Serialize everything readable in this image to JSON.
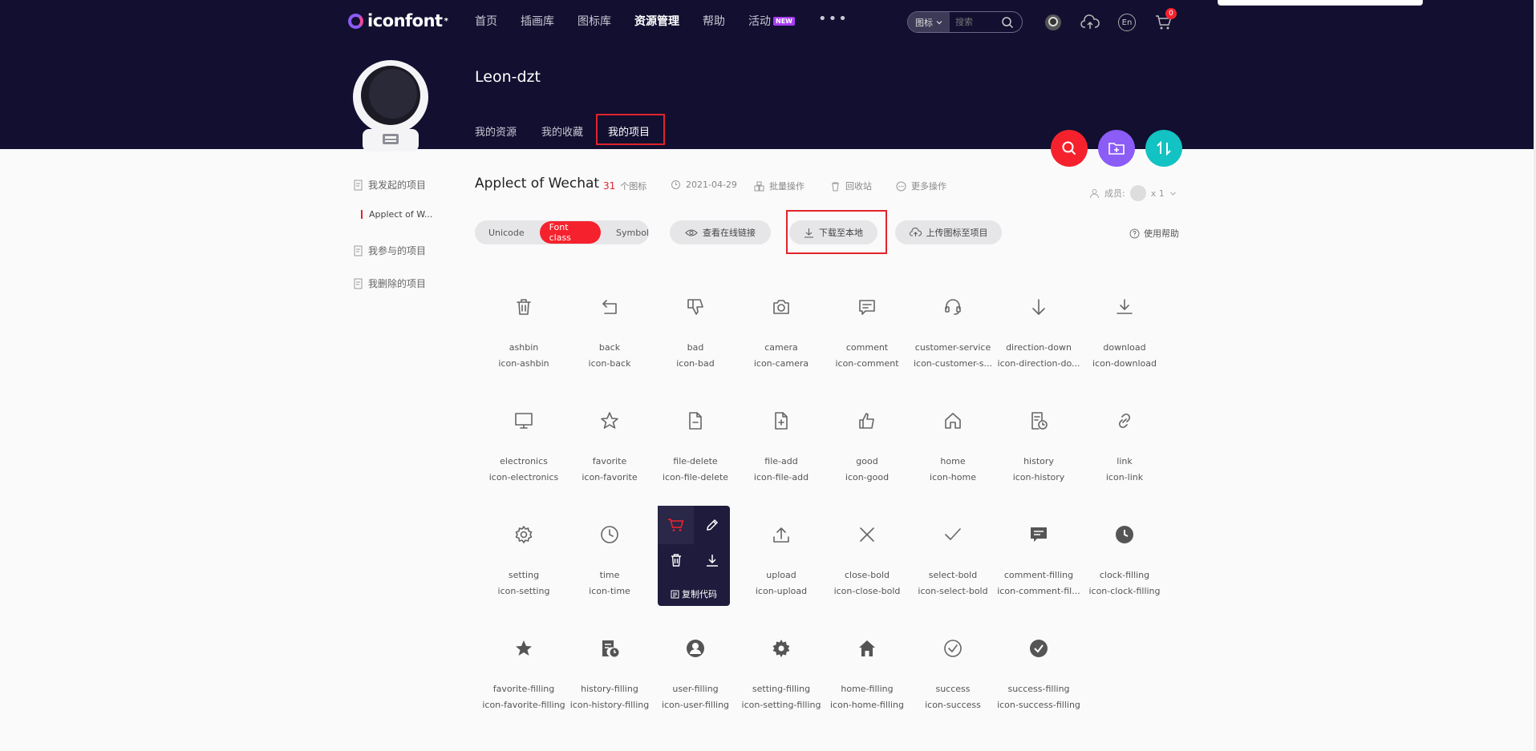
{
  "header": {
    "logo_text": "iconfont",
    "logo_sup": "*",
    "nav": [
      "首页",
      "插画库",
      "图标库",
      "资源管理",
      "帮助",
      "活动"
    ],
    "nav_active_index": 3,
    "new_badge": "NEW",
    "more": "•••",
    "search_type": "图标",
    "search_placeholder": "搜索",
    "lang": "En",
    "cart_count": "0"
  },
  "profile": {
    "username": "Leon-dzt",
    "tabs": [
      "我的资源",
      "我的收藏",
      "我的项目"
    ],
    "active_tab_index": 2
  },
  "sidebar": {
    "started": "我发起的项目",
    "current_project": "Applect of W...",
    "joined": "我参与的项目",
    "deleted": "我删除的项目"
  },
  "project": {
    "title": "Applect of Wechat",
    "icon_count": "31",
    "icon_count_unit": "个图标",
    "date": "2021-04-29",
    "batch": "批量操作",
    "recycle": "回收站",
    "more_ops": "更多操作",
    "members_label": "成员:",
    "members_count": "x 1"
  },
  "toolbar": {
    "modes": [
      "Unicode",
      "Font class",
      "Symbol"
    ],
    "active_mode_index": 1,
    "view_online": "查看在线链接",
    "download": "下载至本地",
    "upload": "上传图标至项目",
    "help": "使用帮助"
  },
  "hover_card": {
    "copy_label": "复制代码"
  },
  "icons": [
    {
      "name": "ashbin",
      "cls": "icon-ashbin",
      "glyph": "trash-icon"
    },
    {
      "name": "back",
      "cls": "icon-back",
      "glyph": "back-icon"
    },
    {
      "name": "bad",
      "cls": "icon-bad",
      "glyph": "thumb-down-icon"
    },
    {
      "name": "camera",
      "cls": "icon-camera",
      "glyph": "camera-icon"
    },
    {
      "name": "comment",
      "cls": "icon-comment",
      "glyph": "comment-icon"
    },
    {
      "name": "customer-service",
      "cls": "icon-customer-s...",
      "glyph": "headset-icon"
    },
    {
      "name": "direction-down",
      "cls": "icon-direction-do...",
      "glyph": "arrow-down-icon"
    },
    {
      "name": "download",
      "cls": "icon-download",
      "glyph": "download-icon"
    },
    {
      "name": "electronics",
      "cls": "icon-electronics",
      "glyph": "monitor-icon"
    },
    {
      "name": "favorite",
      "cls": "icon-favorite",
      "glyph": "star-icon"
    },
    {
      "name": "file-delete",
      "cls": "icon-file-delete",
      "glyph": "file-minus-icon"
    },
    {
      "name": "file-add",
      "cls": "icon-file-add",
      "glyph": "file-plus-icon"
    },
    {
      "name": "good",
      "cls": "icon-good",
      "glyph": "thumb-up-icon"
    },
    {
      "name": "home",
      "cls": "icon-home",
      "glyph": "home-icon"
    },
    {
      "name": "history",
      "cls": "icon-history",
      "glyph": "history-icon"
    },
    {
      "name": "link",
      "cls": "icon-link",
      "glyph": "link-icon"
    },
    {
      "name": "setting",
      "cls": "icon-setting",
      "glyph": "gear-icon"
    },
    {
      "name": "time",
      "cls": "icon-time",
      "glyph": "clock-icon"
    },
    {
      "name": "",
      "cls": "",
      "glyph": "hidden-icon"
    },
    {
      "name": "upload",
      "cls": "icon-upload",
      "glyph": "upload-icon"
    },
    {
      "name": "close-bold",
      "cls": "icon-close-bold",
      "glyph": "close-icon"
    },
    {
      "name": "select-bold",
      "cls": "icon-select-bold",
      "glyph": "check-icon"
    },
    {
      "name": "comment-filling",
      "cls": "icon-comment-fil...",
      "glyph": "comment-filled-icon"
    },
    {
      "name": "clock-filling",
      "cls": "icon-clock-filling",
      "glyph": "clock-filled-icon"
    },
    {
      "name": "favorite-filling",
      "cls": "icon-favorite-filling",
      "glyph": "star-filled-icon"
    },
    {
      "name": "history-filling",
      "cls": "icon-history-filling",
      "glyph": "history-filled-icon"
    },
    {
      "name": "user-filling",
      "cls": "icon-user-filling",
      "glyph": "user-filled-icon"
    },
    {
      "name": "setting-filling",
      "cls": "icon-setting-filling",
      "glyph": "gear-filled-icon"
    },
    {
      "name": "home-filling",
      "cls": "icon-home-filling",
      "glyph": "home-filled-icon"
    },
    {
      "name": "success",
      "cls": "icon-success",
      "glyph": "check-circle-icon"
    },
    {
      "name": "success-filling",
      "cls": "icon-success-filling",
      "glyph": "check-circle-filled-icon"
    }
  ],
  "colors": {
    "header_bg": "#120f30",
    "accent_red": "#f5222d",
    "fab_purple": "#8b5cf6",
    "fab_teal": "#13c2c2"
  }
}
